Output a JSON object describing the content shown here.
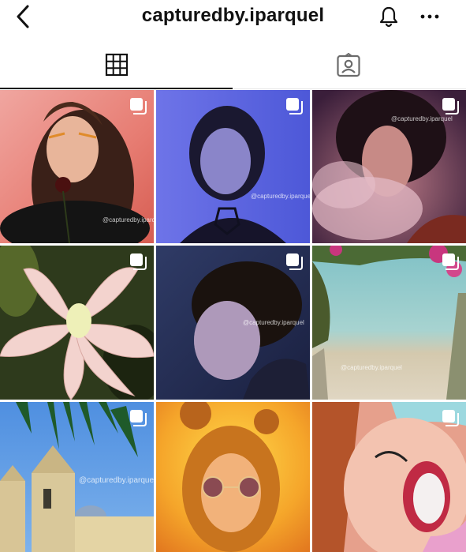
{
  "header": {
    "title": "capturedby.iparquel",
    "back_icon": "chevron-left-icon",
    "bell_icon": "bell-icon",
    "more_icon": "more-horizontal-icon"
  },
  "tabs": [
    {
      "icon": "grid-icon",
      "selected": true
    },
    {
      "icon": "tagged-person-icon",
      "selected": false
    }
  ],
  "posts": [
    {
      "subject": "girl with glitter hair holding rose",
      "multi": true,
      "watermark": "@capturedby.iparquel"
    },
    {
      "subject": "woman in blue light",
      "multi": true,
      "watermark": "@capturedby.iparquel"
    },
    {
      "subject": "man with smoke",
      "multi": true,
      "watermark": "@capturedby.iparquel"
    },
    {
      "subject": "pink lily flower",
      "multi": true,
      "watermark": ""
    },
    {
      "subject": "curly haired boy profile",
      "multi": true,
      "watermark": "@capturedby.iparquel"
    },
    {
      "subject": "beach with bougainvillea",
      "multi": true,
      "watermark": "@capturedby.iparquel"
    },
    {
      "subject": "church towers under blue sky",
      "multi": true,
      "watermark": "@capturedby.iparquel"
    },
    {
      "subject": "girl with round sunglasses",
      "multi": false,
      "watermark": ""
    },
    {
      "subject": "laughing woman with glitter",
      "multi": true,
      "watermark": ""
    }
  ]
}
